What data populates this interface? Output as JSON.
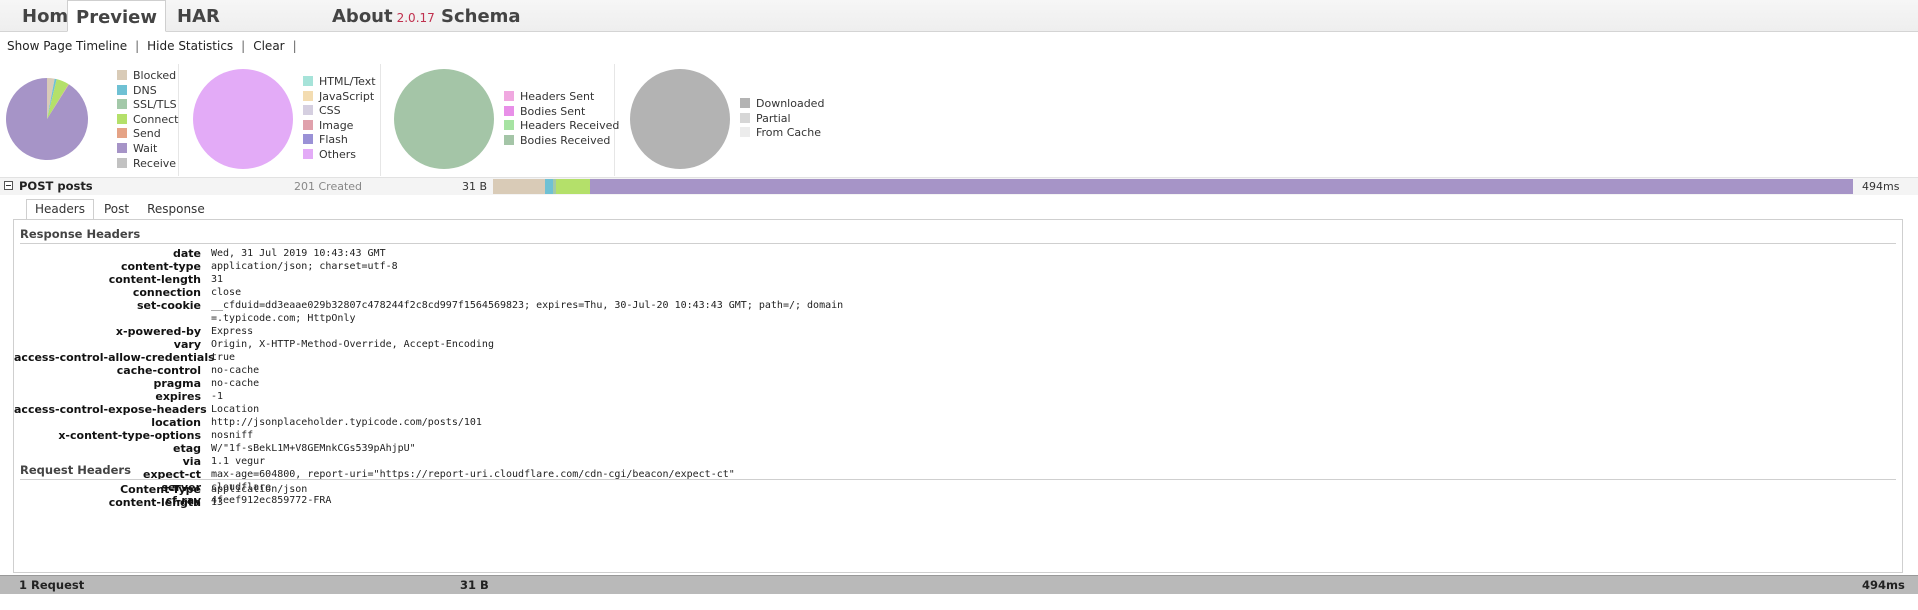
{
  "nav": {
    "home": "Home",
    "preview": "Preview",
    "har": "HAR",
    "about": "About",
    "version": "2.0.17",
    "schema": "Schema"
  },
  "toolbar": {
    "show_timeline": "Show Page Timeline",
    "hide_stats": "Hide Statistics",
    "clear": "Clear",
    "sep": "|"
  },
  "stats": {
    "timing": {
      "legend": [
        {
          "label": "Blocked",
          "color": "#d9cbb7"
        },
        {
          "label": "DNS",
          "color": "#6fc1d4"
        },
        {
          "label": "SSL/TLS",
          "color": "#a3c9a9"
        },
        {
          "label": "Connect",
          "color": "#b4e06a"
        },
        {
          "label": "Send",
          "color": "#e5a386"
        },
        {
          "label": "Wait",
          "color": "#a694c7"
        },
        {
          "label": "Receive",
          "color": "#c2c2c2"
        }
      ],
      "slices": [
        {
          "label": "Blocked",
          "value": 0.03,
          "color": "#d9cbb7"
        },
        {
          "label": "DNS",
          "value": 0.008,
          "color": "#6fc1d4"
        },
        {
          "label": "Connect",
          "value": 0.05,
          "color": "#b4e06a"
        },
        {
          "label": "Send",
          "value": 0.002,
          "color": "#e5a386"
        },
        {
          "label": "Wait",
          "value": 0.91,
          "color": "#a694c7"
        }
      ]
    },
    "content": {
      "legend": [
        {
          "label": "HTML/Text",
          "color": "#a6e3d9"
        },
        {
          "label": "JavaScript",
          "color": "#f3dcb1"
        },
        {
          "label": "CSS",
          "color": "#d5cfe0"
        },
        {
          "label": "Image",
          "color": "#e0a1ac"
        },
        {
          "label": "Flash",
          "color": "#9a91d6"
        },
        {
          "label": "Others",
          "color": "#e3abf7"
        }
      ],
      "fill": "#e3abf7"
    },
    "traffic": {
      "legend": [
        {
          "label": "Headers Sent",
          "color": "#f0a8e0"
        },
        {
          "label": "Bodies Sent",
          "color": "#e88fe8"
        },
        {
          "label": "Headers Received",
          "color": "#a6e3a2"
        },
        {
          "label": "Bodies Received",
          "color": "#a4c5a7"
        }
      ],
      "fill": "#a4c5a7"
    },
    "cache": {
      "legend": [
        {
          "label": "Downloaded",
          "color": "#b3b3b3"
        },
        {
          "label": "Partial",
          "color": "#d6d6d6"
        },
        {
          "label": "From Cache",
          "color": "#ececec"
        }
      ],
      "fill": "#b3b3b3"
    }
  },
  "request": {
    "name": "POST posts",
    "status": "201 Created",
    "size": "31 B",
    "time": "494ms",
    "timeline": [
      {
        "phase": "Blocked",
        "value": 0.038,
        "color": "#d9cbb7"
      },
      {
        "phase": "DNS",
        "value": 0.006,
        "color": "#6fc1d4"
      },
      {
        "phase": "SSL/TLS",
        "value": 0.002,
        "color": "#a3c9a9"
      },
      {
        "phase": "Connect",
        "value": 0.025,
        "color": "#b4e06a"
      },
      {
        "phase": "Wait",
        "value": 0.929,
        "color": "#a694c7"
      }
    ]
  },
  "detail_tabs": [
    "Headers",
    "Post",
    "Response"
  ],
  "response_headers": {
    "title": "Response Headers",
    "rows": [
      {
        "key": "date",
        "value": "Wed, 31 Jul 2019 10:43:43 GMT"
      },
      {
        "key": "content-type",
        "value": "application/json; charset=utf-8"
      },
      {
        "key": "content-length",
        "value": "31"
      },
      {
        "key": "connection",
        "value": "close"
      },
      {
        "key": "set-cookie",
        "value": "__cfduid=dd3eaae029b32807c478244f2c8cd997f1564569823; expires=Thu, 30-Jul-20 10:43:43 GMT; path=/; domain",
        "value2": "=.typicode.com; HttpOnly"
      },
      {
        "key": "x-powered-by",
        "value": "Express"
      },
      {
        "key": "vary",
        "value": "Origin, X-HTTP-Method-Override, Accept-Encoding"
      },
      {
        "key": "access-control-allow-credentials",
        "value": "true"
      },
      {
        "key": "cache-control",
        "value": "no-cache"
      },
      {
        "key": "pragma",
        "value": "no-cache"
      },
      {
        "key": "expires",
        "value": "-1"
      },
      {
        "key": "access-control-expose-headers",
        "value": "Location"
      },
      {
        "key": "location",
        "value": "http://jsonplaceholder.typicode.com/posts/101"
      },
      {
        "key": "x-content-type-options",
        "value": "nosniff"
      },
      {
        "key": "etag",
        "value": "W/\"1f-sBekL1M+V8GEMnkCGs539pAhjpU\""
      },
      {
        "key": "via",
        "value": "1.1 vegur"
      },
      {
        "key": "expect-ct",
        "value": "max-age=604800, report-uri=\"https://report-uri.cloudflare.com/cdn-cgi/beacon/expect-ct\""
      },
      {
        "key": "server",
        "value": "cloudflare"
      },
      {
        "key": "cf-ray",
        "value": "4feef912ec859772-FRA"
      }
    ]
  },
  "request_headers": {
    "title": "Request Headers",
    "rows": [
      {
        "key": "Content-Type",
        "value": "application/json"
      },
      {
        "key": "content-length",
        "value": "13"
      }
    ]
  },
  "footer": {
    "count": "1 Request",
    "size": "31 B",
    "time": "494ms"
  }
}
